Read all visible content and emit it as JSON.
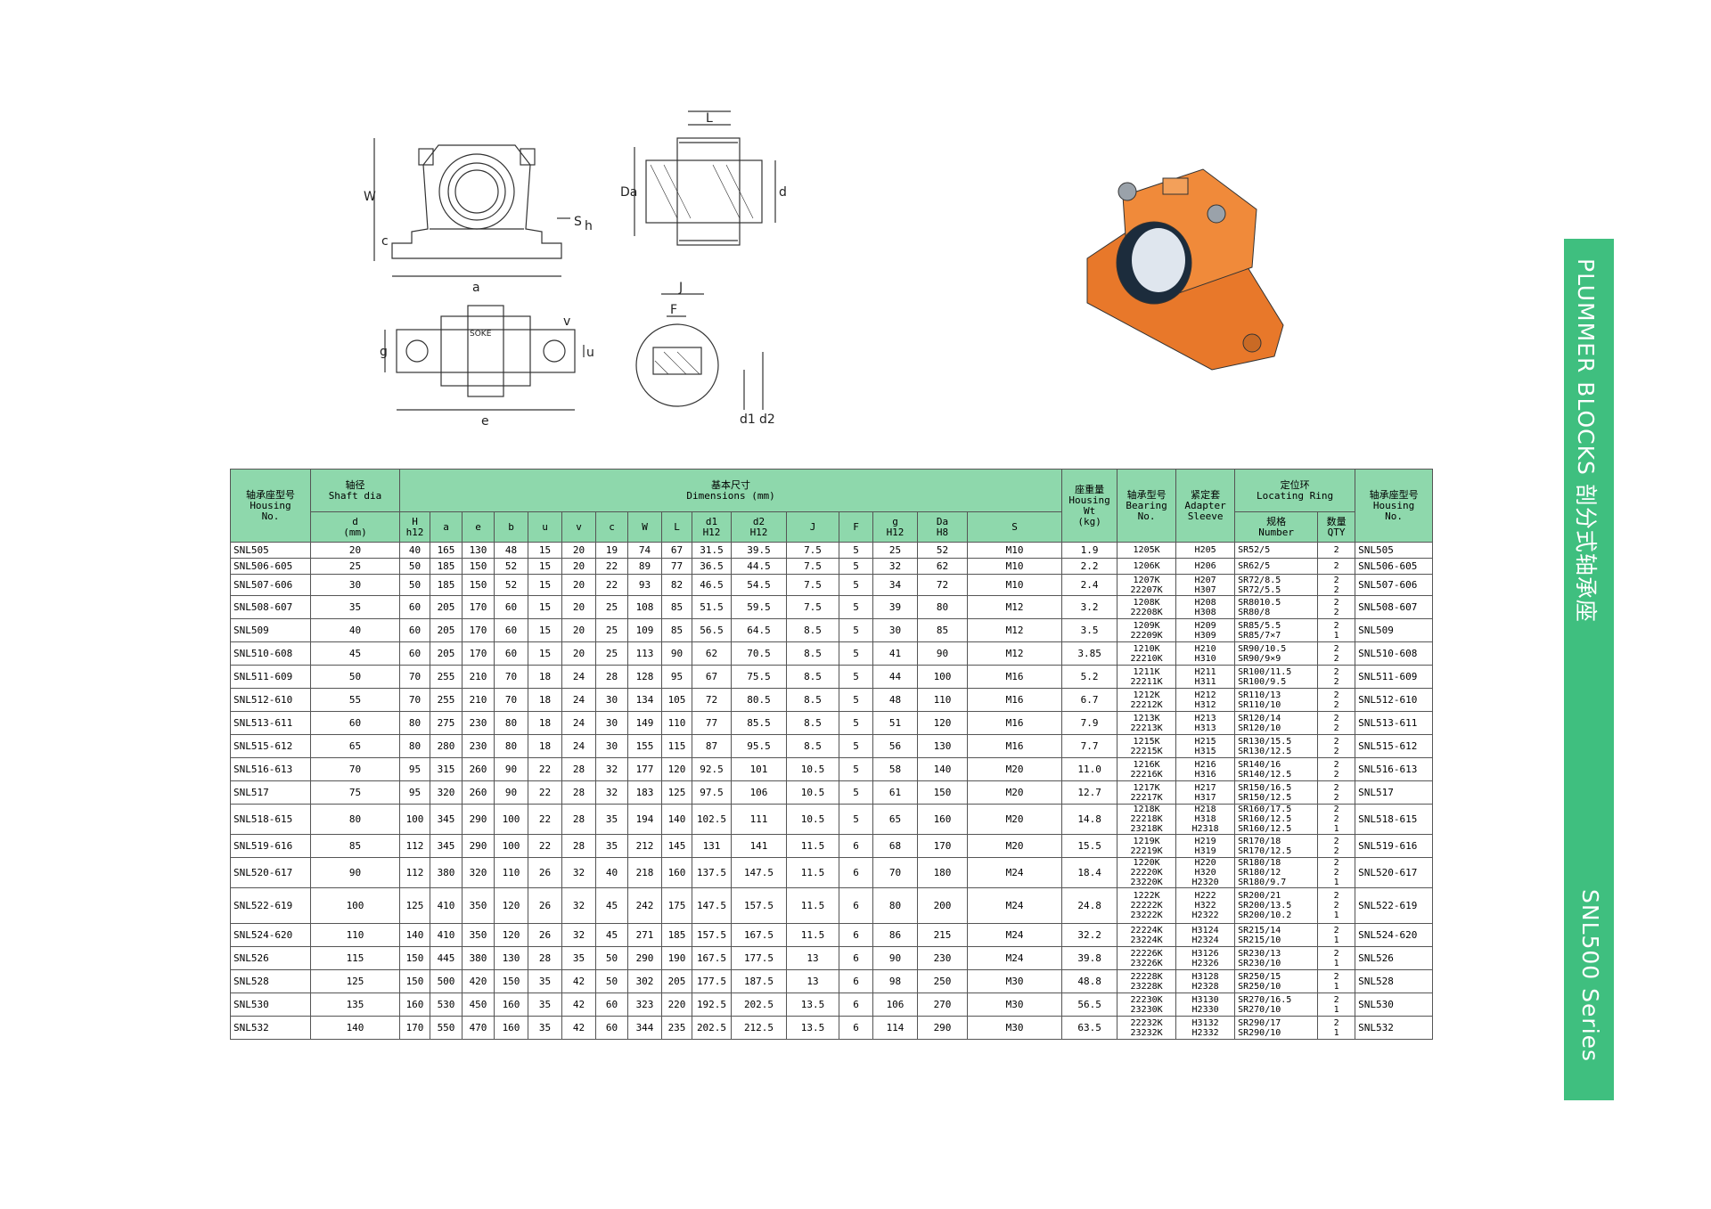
{
  "drawing": {
    "dimension_letters": {
      "W": "W",
      "c": "c",
      "S": "S",
      "h": "h",
      "a": "a",
      "L": "L",
      "Da": "Da",
      "d": "d",
      "g": "g",
      "v": "v",
      "u": "u",
      "e": "e",
      "J": "J",
      "F": "F",
      "d1": "d1",
      "d2": "d2"
    },
    "brand": "SOKE",
    "model_mark": "SNL506-605"
  },
  "banner": {
    "title": "PLUMMER BLOCKS  剖分式轴承座",
    "series": "SNL500 Series",
    "color": "#3fbf7f"
  },
  "table": {
    "header_color": "#8ed8ac",
    "headers": {
      "housing": "轴承座型号\nHousing\nNo.",
      "shaft": "轴径\nShaft dia",
      "dims": "基本尺寸\nDimensions (mm)",
      "weight": "座重量\nHousing\nWt\n(kg)",
      "bearing": "轴承型号\nBearing\nNo.",
      "adapter": "紧定套\nAdapter\nSleeve",
      "ring": "定位环\nLocating Ring",
      "housing_right": "轴承座型号\nHousing\nNo.",
      "d_mm": "d\n(mm)",
      "H": "H\nh12",
      "a": "a",
      "e": "e",
      "b": "b",
      "u": "u",
      "v": "v",
      "c": "c",
      "W": "W",
      "L": "L",
      "d1": "d1\nH12",
      "d2": "d2\nH12",
      "J": "J",
      "F": "F",
      "g": "g\nH12",
      "Da": "Da\nH8",
      "S": "S",
      "ring_spec": "规格\nNumber",
      "ring_qty": "数量\nQTY"
    },
    "rows": [
      {
        "no": "SNL505",
        "d": "20",
        "H": "40",
        "a": "165",
        "e": "130",
        "b": "48",
        "u": "15",
        "v": "20",
        "c": "19",
        "W": "74",
        "L": "67",
        "d1": "31.5",
        "d2": "39.5",
        "J": "7.5",
        "F": "5",
        "g": "25",
        "Da": "52",
        "S": "M10",
        "wt": "1.9",
        "bearing": "1205K",
        "adapter": "H205",
        "ring": "SR52/5",
        "qty": "2"
      },
      {
        "no": "SNL506-605",
        "d": "25",
        "H": "50",
        "a": "185",
        "e": "150",
        "b": "52",
        "u": "15",
        "v": "20",
        "c": "22",
        "W": "89",
        "L": "77",
        "d1": "36.5",
        "d2": "44.5",
        "J": "7.5",
        "F": "5",
        "g": "32",
        "Da": "62",
        "S": "M10",
        "wt": "2.2",
        "bearing": "1206K",
        "adapter": "H206",
        "ring": "SR62/5",
        "qty": "2"
      },
      {
        "no": "SNL507-606",
        "d": "30",
        "H": "50",
        "a": "185",
        "e": "150",
        "b": "52",
        "u": "15",
        "v": "20",
        "c": "22",
        "W": "93",
        "L": "82",
        "d1": "46.5",
        "d2": "54.5",
        "J": "7.5",
        "F": "5",
        "g": "34",
        "Da": "72",
        "S": "M10",
        "wt": "2.4",
        "bearing": "1207K\n22207K",
        "adapter": "H207\nH307",
        "ring": "SR72/8.5\nSR72/5.5",
        "qty": "2\n2"
      },
      {
        "no": "SNL508-607",
        "d": "35",
        "H": "60",
        "a": "205",
        "e": "170",
        "b": "60",
        "u": "15",
        "v": "20",
        "c": "25",
        "W": "108",
        "L": "85",
        "d1": "51.5",
        "d2": "59.5",
        "J": "7.5",
        "F": "5",
        "g": "39",
        "Da": "80",
        "S": "M12",
        "wt": "3.2",
        "bearing": "1208K\n22208K",
        "adapter": "H208\nH308",
        "ring": "SR8010.5\nSR80/8",
        "qty": "2\n2"
      },
      {
        "no": "SNL509",
        "d": "40",
        "H": "60",
        "a": "205",
        "e": "170",
        "b": "60",
        "u": "15",
        "v": "20",
        "c": "25",
        "W": "109",
        "L": "85",
        "d1": "56.5",
        "d2": "64.5",
        "J": "8.5",
        "F": "5",
        "g": "30",
        "Da": "85",
        "S": "M12",
        "wt": "3.5",
        "bearing": "1209K\n22209K",
        "adapter": "H209\nH309",
        "ring": "SR85/5.5\nSR85/7×7",
        "qty": "2\n1"
      },
      {
        "no": "SNL510-608",
        "d": "45",
        "H": "60",
        "a": "205",
        "e": "170",
        "b": "60",
        "u": "15",
        "v": "20",
        "c": "25",
        "W": "113",
        "L": "90",
        "d1": "62",
        "d2": "70.5",
        "J": "8.5",
        "F": "5",
        "g": "41",
        "Da": "90",
        "S": "M12",
        "wt": "3.85",
        "bearing": "1210K\n22210K",
        "adapter": "H210\nH310",
        "ring": "SR90/10.5\nSR90/9×9",
        "qty": "2\n2"
      },
      {
        "no": "SNL511-609",
        "d": "50",
        "H": "70",
        "a": "255",
        "e": "210",
        "b": "70",
        "u": "18",
        "v": "24",
        "c": "28",
        "W": "128",
        "L": "95",
        "d1": "67",
        "d2": "75.5",
        "J": "8.5",
        "F": "5",
        "g": "44",
        "Da": "100",
        "S": "M16",
        "wt": "5.2",
        "bearing": "1211K\n22211K",
        "adapter": "H211\nH311",
        "ring": "SR100/11.5\nSR100/9.5",
        "qty": "2\n2"
      },
      {
        "no": "SNL512-610",
        "d": "55",
        "H": "70",
        "a": "255",
        "e": "210",
        "b": "70",
        "u": "18",
        "v": "24",
        "c": "30",
        "W": "134",
        "L": "105",
        "d1": "72",
        "d2": "80.5",
        "J": "8.5",
        "F": "5",
        "g": "48",
        "Da": "110",
        "S": "M16",
        "wt": "6.7",
        "bearing": "1212K\n22212K",
        "adapter": "H212\nH312",
        "ring": "SR110/13\nSR110/10",
        "qty": "2\n2"
      },
      {
        "no": "SNL513-611",
        "d": "60",
        "H": "80",
        "a": "275",
        "e": "230",
        "b": "80",
        "u": "18",
        "v": "24",
        "c": "30",
        "W": "149",
        "L": "110",
        "d1": "77",
        "d2": "85.5",
        "J": "8.5",
        "F": "5",
        "g": "51",
        "Da": "120",
        "S": "M16",
        "wt": "7.9",
        "bearing": "1213K\n22213K",
        "adapter": "H213\nH313",
        "ring": "SR120/14\nSR120/10",
        "qty": "2\n2"
      },
      {
        "no": "SNL515-612",
        "d": "65",
        "H": "80",
        "a": "280",
        "e": "230",
        "b": "80",
        "u": "18",
        "v": "24",
        "c": "30",
        "W": "155",
        "L": "115",
        "d1": "87",
        "d2": "95.5",
        "J": "8.5",
        "F": "5",
        "g": "56",
        "Da": "130",
        "S": "M16",
        "wt": "7.7",
        "bearing": "1215K\n22215K",
        "adapter": "H215\nH315",
        "ring": "SR130/15.5\nSR130/12.5",
        "qty": "2\n2"
      },
      {
        "no": "SNL516-613",
        "d": "70",
        "H": "95",
        "a": "315",
        "e": "260",
        "b": "90",
        "u": "22",
        "v": "28",
        "c": "32",
        "W": "177",
        "L": "120",
        "d1": "92.5",
        "d2": "101",
        "J": "10.5",
        "F": "5",
        "g": "58",
        "Da": "140",
        "S": "M20",
        "wt": "11.0",
        "bearing": "1216K\n22216K",
        "adapter": "H216\nH316",
        "ring": "SR140/16\nSR140/12.5",
        "qty": "2\n2"
      },
      {
        "no": "SNL517",
        "d": "75",
        "H": "95",
        "a": "320",
        "e": "260",
        "b": "90",
        "u": "22",
        "v": "28",
        "c": "32",
        "W": "183",
        "L": "125",
        "d1": "97.5",
        "d2": "106",
        "J": "10.5",
        "F": "5",
        "g": "61",
        "Da": "150",
        "S": "M20",
        "wt": "12.7",
        "bearing": "1217K\n22217K",
        "adapter": "H217\nH317",
        "ring": "SR150/16.5\nSR150/12.5",
        "qty": "2\n2"
      },
      {
        "no": "SNL518-615",
        "d": "80",
        "H": "100",
        "a": "345",
        "e": "290",
        "b": "100",
        "u": "22",
        "v": "28",
        "c": "35",
        "W": "194",
        "L": "140",
        "d1": "102.5",
        "d2": "111",
        "J": "10.5",
        "F": "5",
        "g": "65",
        "Da": "160",
        "S": "M20",
        "wt": "14.8",
        "bearing": "1218K\n22218K\n23218K",
        "adapter": "H218\nH318\nH2318",
        "ring": "SR160/17.5\nSR160/12.5\nSR160/12.5",
        "qty": "2\n2\n1"
      },
      {
        "no": "SNL519-616",
        "d": "85",
        "H": "112",
        "a": "345",
        "e": "290",
        "b": "100",
        "u": "22",
        "v": "28",
        "c": "35",
        "W": "212",
        "L": "145",
        "d1": "131",
        "d2": "141",
        "J": "11.5",
        "F": "6",
        "g": "68",
        "Da": "170",
        "S": "M20",
        "wt": "15.5",
        "bearing": "1219K\n22219K",
        "adapter": "H219\nH319",
        "ring": "SR170/18\nSR170/12.5",
        "qty": "2\n2"
      },
      {
        "no": "SNL520-617",
        "d": "90",
        "H": "112",
        "a": "380",
        "e": "320",
        "b": "110",
        "u": "26",
        "v": "32",
        "c": "40",
        "W": "218",
        "L": "160",
        "d1": "137.5",
        "d2": "147.5",
        "J": "11.5",
        "F": "6",
        "g": "70",
        "Da": "180",
        "S": "M24",
        "wt": "18.4",
        "bearing": "1220K\n22220K\n23220K",
        "adapter": "H220\nH320\nH2320",
        "ring": "SR180/18\nSR180/12\nSR180/9.7",
        "qty": "2\n2\n1"
      },
      {
        "no": "SNL522-619",
        "d": "100",
        "H": "125",
        "a": "410",
        "e": "350",
        "b": "120",
        "u": "26",
        "v": "32",
        "c": "45",
        "W": "242",
        "L": "175",
        "d1": "147.5",
        "d2": "157.5",
        "J": "11.5",
        "F": "6",
        "g": "80",
        "Da": "200",
        "S": "M24",
        "wt": "24.8",
        "bearing": "1222K\n22222K\n23222K",
        "adapter": "H222\nH322\nH2322",
        "ring": "SR200/21\nSR200/13.5\nSR200/10.2",
        "qty": "2\n2\n1"
      },
      {
        "no": "SNL524-620",
        "d": "110",
        "H": "140",
        "a": "410",
        "e": "350",
        "b": "120",
        "u": "26",
        "v": "32",
        "c": "45",
        "W": "271",
        "L": "185",
        "d1": "157.5",
        "d2": "167.5",
        "J": "11.5",
        "F": "6",
        "g": "86",
        "Da": "215",
        "S": "M24",
        "wt": "32.2",
        "bearing": "22224K\n23224K",
        "adapter": "H3124\nH2324",
        "ring": "SR215/14\nSR215/10",
        "qty": "2\n1"
      },
      {
        "no": "SNL526",
        "d": "115",
        "H": "150",
        "a": "445",
        "e": "380",
        "b": "130",
        "u": "28",
        "v": "35",
        "c": "50",
        "W": "290",
        "L": "190",
        "d1": "167.5",
        "d2": "177.5",
        "J": "13",
        "F": "6",
        "g": "90",
        "Da": "230",
        "S": "M24",
        "wt": "39.8",
        "bearing": "22226K\n23226K",
        "adapter": "H3126\nH2326",
        "ring": "SR230/13\nSR230/10",
        "qty": "2\n1"
      },
      {
        "no": "SNL528",
        "d": "125",
        "H": "150",
        "a": "500",
        "e": "420",
        "b": "150",
        "u": "35",
        "v": "42",
        "c": "50",
        "W": "302",
        "L": "205",
        "d1": "177.5",
        "d2": "187.5",
        "J": "13",
        "F": "6",
        "g": "98",
        "Da": "250",
        "S": "M30",
        "wt": "48.8",
        "bearing": "22228K\n23228K",
        "adapter": "H3128\nH2328",
        "ring": "SR250/15\nSR250/10",
        "qty": "2\n1"
      },
      {
        "no": "SNL530",
        "d": "135",
        "H": "160",
        "a": "530",
        "e": "450",
        "b": "160",
        "u": "35",
        "v": "42",
        "c": "60",
        "W": "323",
        "L": "220",
        "d1": "192.5",
        "d2": "202.5",
        "J": "13.5",
        "F": "6",
        "g": "106",
        "Da": "270",
        "S": "M30",
        "wt": "56.5",
        "bearing": "22230K\n23230K",
        "adapter": "H3130\nH2330",
        "ring": "SR270/16.5\nSR270/10",
        "qty": "2\n1"
      },
      {
        "no": "SNL532",
        "d": "140",
        "H": "170",
        "a": "550",
        "e": "470",
        "b": "160",
        "u": "35",
        "v": "42",
        "c": "60",
        "W": "344",
        "L": "235",
        "d1": "202.5",
        "d2": "212.5",
        "J": "13.5",
        "F": "6",
        "g": "114",
        "Da": "290",
        "S": "M30",
        "wt": "63.5",
        "bearing": "22232K\n23232K",
        "adapter": "H3132\nH2332",
        "ring": "SR290/17\nSR290/10",
        "qty": "2\n1"
      }
    ]
  }
}
